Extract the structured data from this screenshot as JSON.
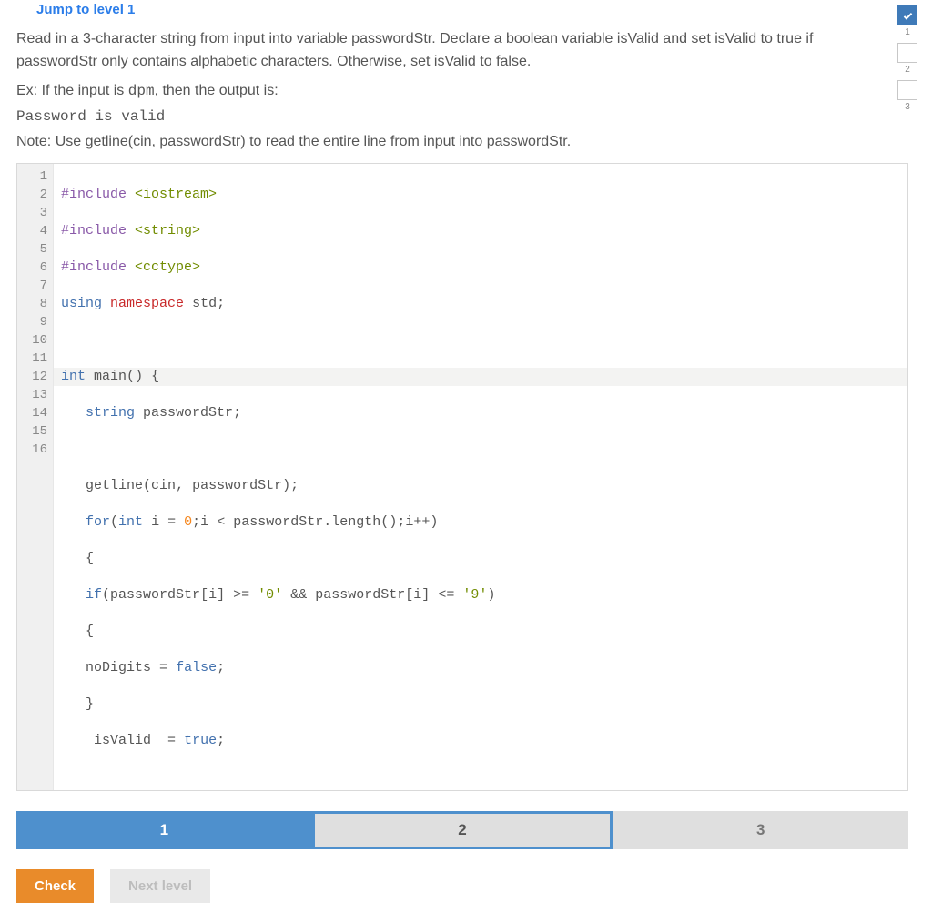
{
  "link": {
    "jump": "Jump to level 1"
  },
  "prompt": {
    "p1": "Read in a 3-character string from input into variable passwordStr. Declare a boolean variable isValid and set isValid to true if passwordStr only contains alphabetic characters. Otherwise, set isValid to false.",
    "ex_prefix": "Ex: If the input is ",
    "ex_value": "dpm",
    "ex_suffix": ", then the output is:",
    "output": "Password is valid",
    "note": "Note: Use getline(cin, passwordStr) to read the entire line from input into passwordStr."
  },
  "code": {
    "line_count": 16,
    "highlighted_line": 12,
    "tokens": {
      "include": "#include",
      "iostream": "<iostream>",
      "string_h": "<string>",
      "cctype": "<cctype>",
      "using": "using",
      "namespace": "namespace",
      "std": "std",
      "int": "int",
      "main": "main",
      "string_t": "string",
      "passwordStr": "passwordStr",
      "getline": "getline",
      "cin": "cin",
      "for": "for",
      "i": "i",
      "zero": "0",
      "length": "length",
      "ipp": "i++",
      "if": "if",
      "gte": ">=",
      "lte": "<=",
      "char0": "'0'",
      "char9": "'9'",
      "andand": "&&",
      "noDigits": "noDigits",
      "false": "false",
      "isValid": "isValid",
      "true": "true",
      "semi": ";",
      "ob": "{",
      "cb": "}",
      "op": "(",
      "cp": ")",
      "osb": "[",
      "csb": "]",
      "comma": ",",
      "eq": "=",
      "lt": "<",
      "dot": "."
    }
  },
  "steps": {
    "s1": "1",
    "s2": "2",
    "s3": "3"
  },
  "buttons": {
    "check": "Check",
    "next": "Next level"
  },
  "progress": {
    "n1": "1",
    "n2": "2",
    "n3": "3"
  }
}
